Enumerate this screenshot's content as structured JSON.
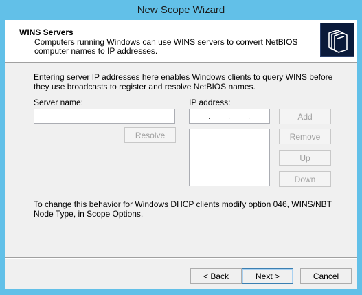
{
  "window": {
    "title": "New Scope Wizard"
  },
  "header": {
    "title": "WINS Servers",
    "description": "Computers running Windows can use WINS servers to convert NetBIOS computer names to IP addresses.",
    "icon": "folders-icon"
  },
  "body": {
    "intro": "Entering server IP addresses here enables Windows clients to query WINS before they use broadcasts to register and resolve NetBIOS names.",
    "server_name_label": "Server name:",
    "server_name_value": "",
    "resolve_label": "Resolve",
    "ip_address_label": "IP address:",
    "ip_address_value": "",
    "add_label": "Add",
    "remove_label": "Remove",
    "up_label": "Up",
    "down_label": "Down",
    "ip_list": [],
    "footnote": "To change this behavior for Windows DHCP clients modify option 046, WINS/NBT Node Type, in Scope Options."
  },
  "footer": {
    "back_label": "< Back",
    "next_label": "Next >",
    "cancel_label": "Cancel"
  }
}
